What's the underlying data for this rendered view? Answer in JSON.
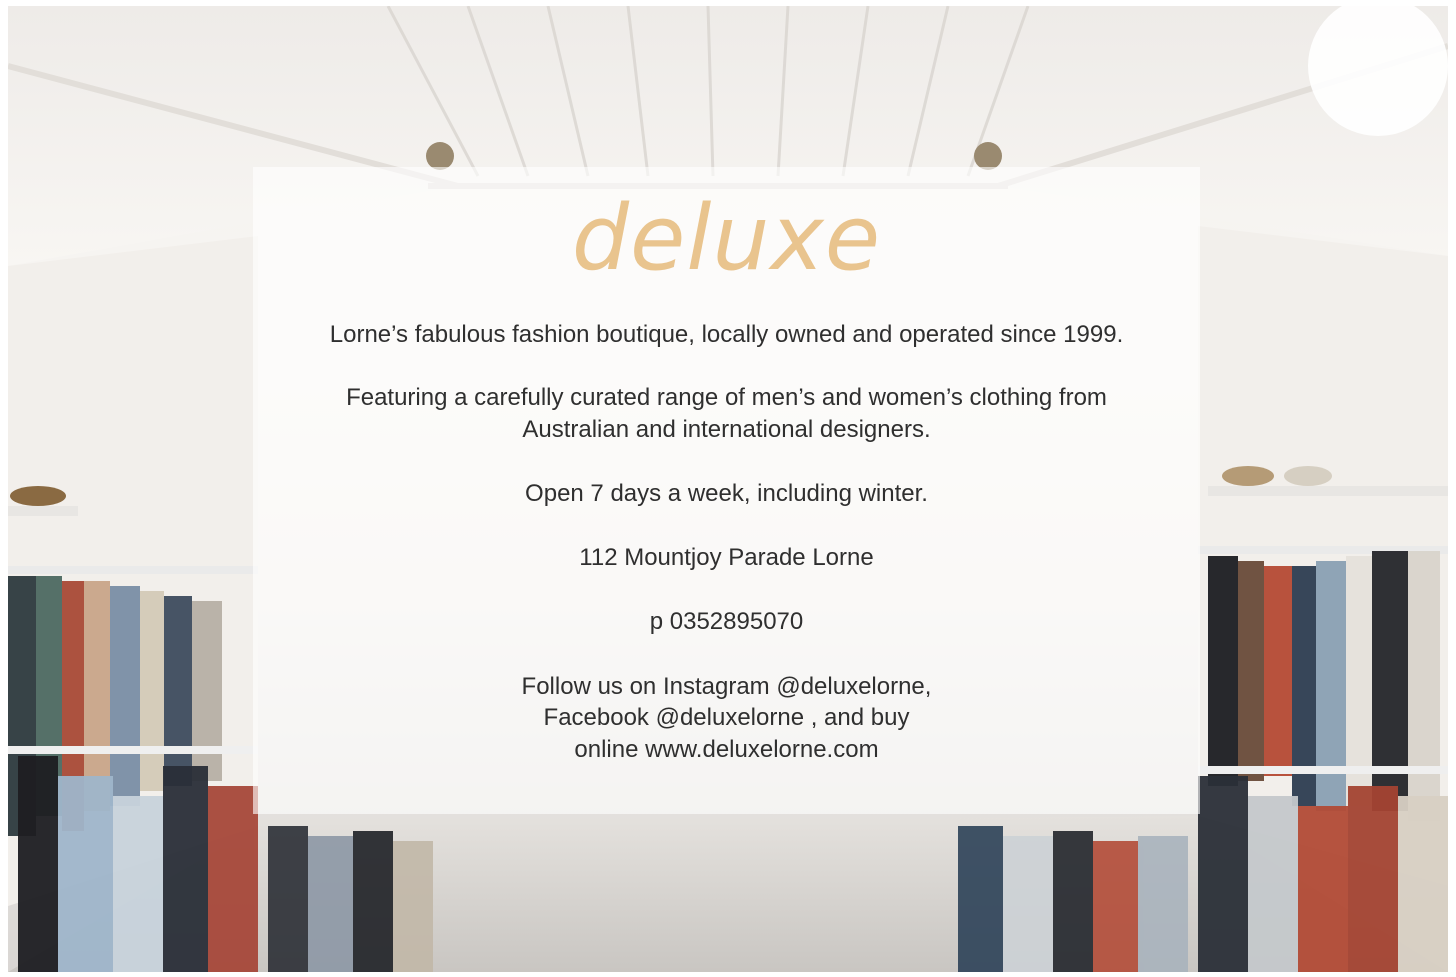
{
  "brand": {
    "name": "deluxe",
    "color": "#e9c48e"
  },
  "info": {
    "tagline": "Lorne’s fabulous fashion boutique, locally owned and operated since 1999.",
    "featuring_line1": "Featuring a carefully curated range of men’s and women’s clothing from",
    "featuring_line2": "Australian and international designers.",
    "hours": "Open 7 days a week, including winter.",
    "address": "112 Mountjoy Parade Lorne",
    "phone": "p 0352895070",
    "social_line1": "Follow us on Instagram @deluxelorne,",
    "social_line2": "Facebook @deluxelorne , and buy",
    "social_line3": "online www.deluxelorne.com"
  },
  "background": {
    "description_icon": "boutique-interior-photo",
    "panel_color": "#ffffff",
    "text_color": "#2f2f2f"
  }
}
